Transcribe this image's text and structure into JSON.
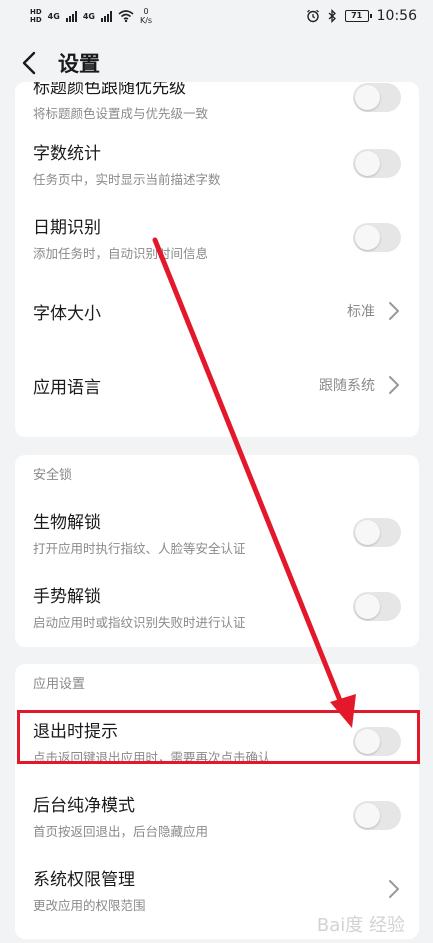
{
  "status_bar": {
    "hd1": "HD",
    "hd2": "HD",
    "signal1": "4G",
    "signal2": "4G",
    "net_speed_value": "0",
    "net_speed_unit": "K/s",
    "battery": "71",
    "time": "10:56"
  },
  "header": {
    "title": "设置"
  },
  "card1": {
    "rows": [
      {
        "title": "标题颜色跟随优先级",
        "subtitle": "将标题颜色设置成与优先级一致"
      },
      {
        "title": "字数统计",
        "subtitle": "任务页中，实时显示当前描述字数"
      },
      {
        "title": "日期识别",
        "subtitle": "添加任务时，自动识别时间信息"
      },
      {
        "title": "字体大小",
        "value": "标准"
      },
      {
        "title": "应用语言",
        "value": "跟随系统"
      }
    ]
  },
  "card2": {
    "section": "安全锁",
    "rows": [
      {
        "title": "生物解锁",
        "subtitle": "打开应用时执行指纹、人脸等安全认证"
      },
      {
        "title": "手势解锁",
        "subtitle": "启动应用时或指纹识别失败时进行认证"
      }
    ]
  },
  "card3": {
    "section": "应用设置",
    "rows": [
      {
        "title": "退出时提示",
        "subtitle": "点击返回键退出应用时，需要再次点击确认"
      },
      {
        "title": "后台纯净模式",
        "subtitle": "首页按返回退出，后台隐藏应用"
      },
      {
        "title": "系统权限管理",
        "subtitle": "更改应用的权限范围"
      }
    ]
  },
  "watermark": "Bai度 经验",
  "colors": {
    "accent_annotation": "#e3182a",
    "background": "#f1f3f5"
  }
}
